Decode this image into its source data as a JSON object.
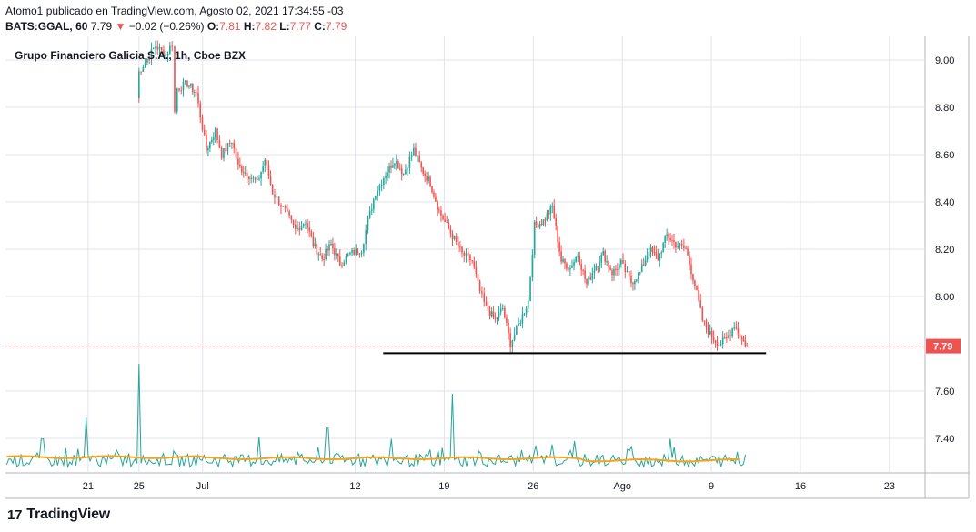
{
  "header": {
    "line1": "Atomo1 publicado en TradingView.com, Agosto 02, 2021 17:34:55 -03",
    "symbol": "BATS:GGAL, 60",
    "last": "7.79",
    "change_arrow": "▼",
    "change": "−0.02 (−0.26%)",
    "o_label": "O:",
    "o": "7.81",
    "h_label": "H:",
    "h": "7.82",
    "l_label": "L:",
    "l": "7.77",
    "c_label": "C:",
    "c": "7.79"
  },
  "footer": {
    "logo_mark": "17",
    "brand": "TradingView"
  },
  "colors": {
    "up": "#26a69a",
    "down": "#ef5350",
    "volume": "#26a69a",
    "volume_ma": "#f7a21b",
    "price_line": "#ef5350",
    "support_line": "#000000"
  },
  "chart_data": {
    "type": "candlestick",
    "title": "Grupo Financiero Galicia S.A., 1h, Cboe BZX",
    "y_ticks": [
      "9.00",
      "8.80",
      "8.60",
      "8.40",
      "8.20",
      "8.00",
      "7.60",
      "7.40"
    ],
    "ylim": [
      7.24,
      9.12
    ],
    "x_ticks": [
      {
        "label": "21",
        "day": 21
      },
      {
        "label": "25",
        "day": 25
      },
      {
        "label": "Jul",
        "day": 30
      },
      {
        "label": "12",
        "day": 42
      },
      {
        "label": "19",
        "day": 49
      },
      {
        "label": "26",
        "day": 56
      },
      {
        "label": "Ago",
        "day": 63
      },
      {
        "label": "9",
        "day": 70
      },
      {
        "label": "16",
        "day": 77
      },
      {
        "label": "23",
        "day": 84
      }
    ],
    "xlim": [
      14.5,
      86.8
    ],
    "last_price": "7.79",
    "support_level": 7.76,
    "support_from_day": 44.2,
    "support_to_day": 74.3,
    "price_path": [
      [
        25.0,
        8.84
      ],
      [
        25.0,
        8.95
      ],
      [
        26.3,
        9.06
      ],
      [
        27.1,
        9.02
      ],
      [
        27.6,
        9.07
      ],
      [
        27.8,
        8.78
      ],
      [
        28.0,
        8.88
      ],
      [
        28.8,
        8.9
      ],
      [
        29.5,
        8.86
      ],
      [
        30.3,
        8.62
      ],
      [
        31.0,
        8.7
      ],
      [
        31.5,
        8.6
      ],
      [
        32.3,
        8.66
      ],
      [
        32.8,
        8.55
      ],
      [
        33.5,
        8.52
      ],
      [
        34.3,
        8.48
      ],
      [
        34.9,
        8.58
      ],
      [
        35.5,
        8.44
      ],
      [
        36.5,
        8.36
      ],
      [
        37.3,
        8.28
      ],
      [
        38.1,
        8.32
      ],
      [
        38.7,
        8.22
      ],
      [
        39.4,
        8.16
      ],
      [
        40.1,
        8.22
      ],
      [
        40.8,
        8.14
      ],
      [
        41.6,
        8.18
      ],
      [
        42.5,
        8.2
      ],
      [
        43.0,
        8.32
      ],
      [
        43.6,
        8.44
      ],
      [
        44.4,
        8.52
      ],
      [
        45.1,
        8.58
      ],
      [
        45.8,
        8.52
      ],
      [
        46.6,
        8.62
      ],
      [
        47.2,
        8.54
      ],
      [
        47.9,
        8.48
      ],
      [
        48.6,
        8.36
      ],
      [
        49.2,
        8.3
      ],
      [
        49.8,
        8.24
      ],
      [
        50.4,
        8.18
      ],
      [
        51.2,
        8.15
      ],
      [
        51.8,
        8.02
      ],
      [
        52.3,
        7.95
      ],
      [
        53.0,
        7.9
      ],
      [
        53.6,
        7.95
      ],
      [
        54.2,
        7.8
      ],
      [
        55.0,
        7.9
      ],
      [
        55.6,
        7.98
      ],
      [
        56.1,
        8.3
      ],
      [
        56.8,
        8.32
      ],
      [
        57.5,
        8.38
      ],
      [
        58.2,
        8.15
      ],
      [
        58.9,
        8.12
      ],
      [
        59.5,
        8.18
      ],
      [
        60.2,
        8.05
      ],
      [
        60.8,
        8.12
      ],
      [
        61.5,
        8.18
      ],
      [
        62.2,
        8.1
      ],
      [
        62.9,
        8.14
      ],
      [
        63.7,
        8.06
      ],
      [
        64.4,
        8.1
      ],
      [
        65.1,
        8.2
      ],
      [
        65.8,
        8.16
      ],
      [
        66.5,
        8.26
      ],
      [
        67.2,
        8.22
      ],
      [
        68.0,
        8.2
      ],
      [
        68.7,
        8.05
      ],
      [
        69.3,
        7.9
      ],
      [
        69.9,
        7.84
      ],
      [
        70.6,
        7.8
      ],
      [
        71.2,
        7.82
      ],
      [
        71.8,
        7.88
      ],
      [
        72.4,
        7.82
      ],
      [
        72.8,
        7.79
      ]
    ],
    "volume_spikes": [
      [
        17.4,
        0.3
      ],
      [
        20.9,
        0.5
      ],
      [
        25.0,
        1.0
      ],
      [
        34.5,
        0.32
      ],
      [
        39.8,
        0.4
      ],
      [
        44.8,
        0.3
      ],
      [
        49.6,
        0.72
      ],
      [
        59.3,
        0.28
      ],
      [
        66.7,
        0.3
      ]
    ],
    "volume_ma_level": 0.12
  }
}
